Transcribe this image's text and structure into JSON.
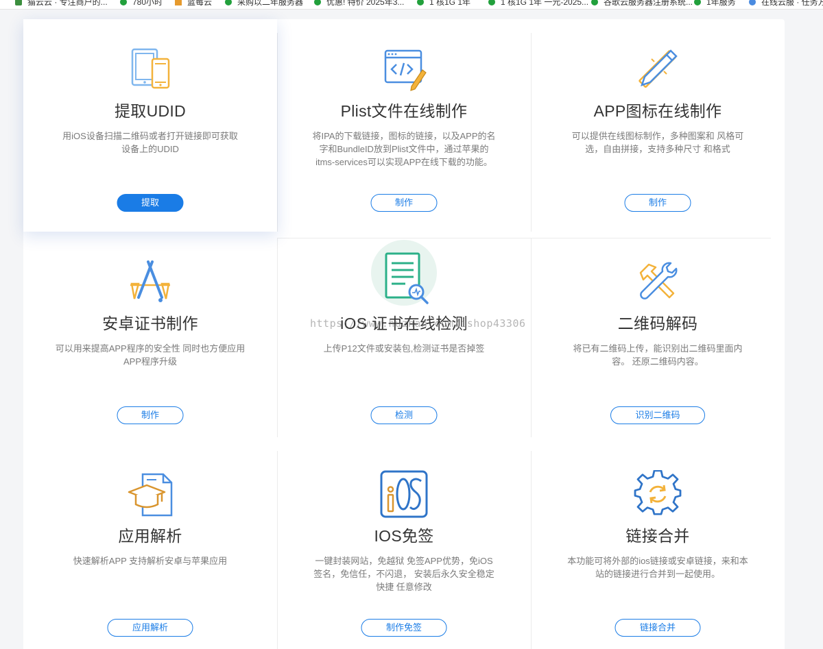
{
  "bookmarks": [
    {
      "label": "猫云云 · 专注商户的...",
      "icon": "green-square-icon",
      "color": "#3b8e3e"
    },
    {
      "label": "780小时",
      "icon": "green-dot-icon",
      "color": "#22a03c"
    },
    {
      "label": "蓝莓云",
      "icon": "orange-triangle-icon",
      "color": "#e69a2d"
    },
    {
      "label": "采购以二年服务器",
      "icon": "green-dot-icon",
      "color": "#22a03c"
    },
    {
      "label": "优惠! 特价 2025年3...",
      "icon": "green-dot-icon",
      "color": "#22a03c"
    },
    {
      "label": "1 核1G 1年",
      "icon": "green-dot-icon",
      "color": "#22a03c"
    },
    {
      "label": "1 核1G 1年 一元-2025...",
      "icon": "green-dot-icon",
      "color": "#22a03c"
    },
    {
      "label": "谷歌云服务器注册系统...",
      "icon": "green-dot-icon",
      "color": "#22a03c"
    },
    {
      "label": "1年服务",
      "icon": "green-dot-icon",
      "color": "#22a03c"
    },
    {
      "label": "在线云服 · 任务方...",
      "icon": "blue-globe-icon",
      "color": "#4a8be0"
    }
  ],
  "watermark": "https://www.huzhan.com/ishop43306",
  "accent": "#1a7ce6",
  "cards": [
    {
      "title": "提取UDID",
      "desc": "用iOS设备扫描二维码或者打开链接即可获取设备上的UDID",
      "button": "提取",
      "icon": "devices-icon"
    },
    {
      "title": "Plist文件在线制作",
      "desc": "将IPA的下载链接，图标的链接，以及APP的名字和BundleID放到Plist文件中，通过苹果的itms-services可以实现APP在线下载的功能。",
      "button": "制作",
      "icon": "code-window-icon"
    },
    {
      "title": "APP图标在线制作",
      "desc": "可以提供在线图标制作，多种图案和 风格可选，自由拼接，支持多种尺寸 和格式",
      "button": "制作",
      "icon": "pencil-ruler-icon"
    },
    {
      "title": "安卓证书制作",
      "desc": "可以用来提高APP程序的安全性 同时也方便应用APP程序升级",
      "button": "制作",
      "icon": "app-store-icon"
    },
    {
      "title": "iOS 证书在线检测",
      "desc": "上传P12文件或安装包,检测证书是否掉签",
      "button": "检测",
      "icon": "document-search-icon"
    },
    {
      "title": "二维码解码",
      "desc": "将已有二维码上传，能识别出二维码里面内容。 还原二维码内容。",
      "button": "识别二维码",
      "icon": "tools-icon"
    },
    {
      "title": "应用解析",
      "desc": "快速解析APP 支持解析安卓与苹果应用",
      "button": "应用解析",
      "icon": "graduation-file-icon"
    },
    {
      "title": "IOS免签",
      "desc": "一键封装网站，免越狱 免签APP优势，免iOS签名，免信任，不闪退， 安装后永久安全稳定快捷 任意修改",
      "button": "制作免签",
      "icon": "ios-badge-icon"
    },
    {
      "title": "链接合并",
      "desc": "本功能可将外部的ios链接或安卓链接，来和本站的链接进行合并到一起使用。",
      "button": "链接合并",
      "icon": "gear-sync-icon"
    }
  ]
}
